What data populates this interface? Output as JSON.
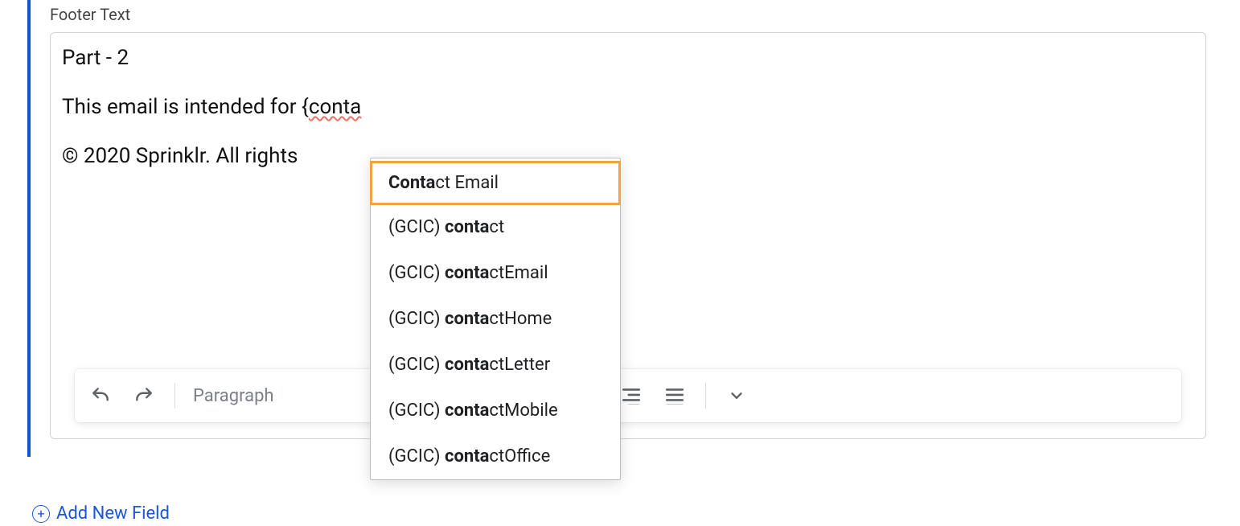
{
  "section": {
    "label": "Footer Text"
  },
  "editor": {
    "line1": "Part - 2",
    "line2_plain": "This email is intended for {",
    "line2_token": "conta",
    "line3": "© 2020 Sprinklr. All rights"
  },
  "autocomplete": {
    "query": "conta",
    "items": [
      {
        "prefix": "",
        "bold": "Conta",
        "rest": "ct Email",
        "selected": true
      },
      {
        "prefix": "(GCIC) ",
        "bold": "conta",
        "rest": "ct",
        "selected": false
      },
      {
        "prefix": "(GCIC) ",
        "bold": "conta",
        "rest": "ctEmail",
        "selected": false
      },
      {
        "prefix": "(GCIC) ",
        "bold": "conta",
        "rest": "ctHome",
        "selected": false
      },
      {
        "prefix": "(GCIC) ",
        "bold": "conta",
        "rest": "ctLetter",
        "selected": false
      },
      {
        "prefix": "(GCIC) ",
        "bold": "conta",
        "rest": "ctMobile",
        "selected": false
      },
      {
        "prefix": "(GCIC) ",
        "bold": "conta",
        "rest": "ctOffice",
        "selected": false
      }
    ]
  },
  "toolbar": {
    "block_style": "Paragraph"
  },
  "add_field": {
    "label": "Add New Field"
  }
}
